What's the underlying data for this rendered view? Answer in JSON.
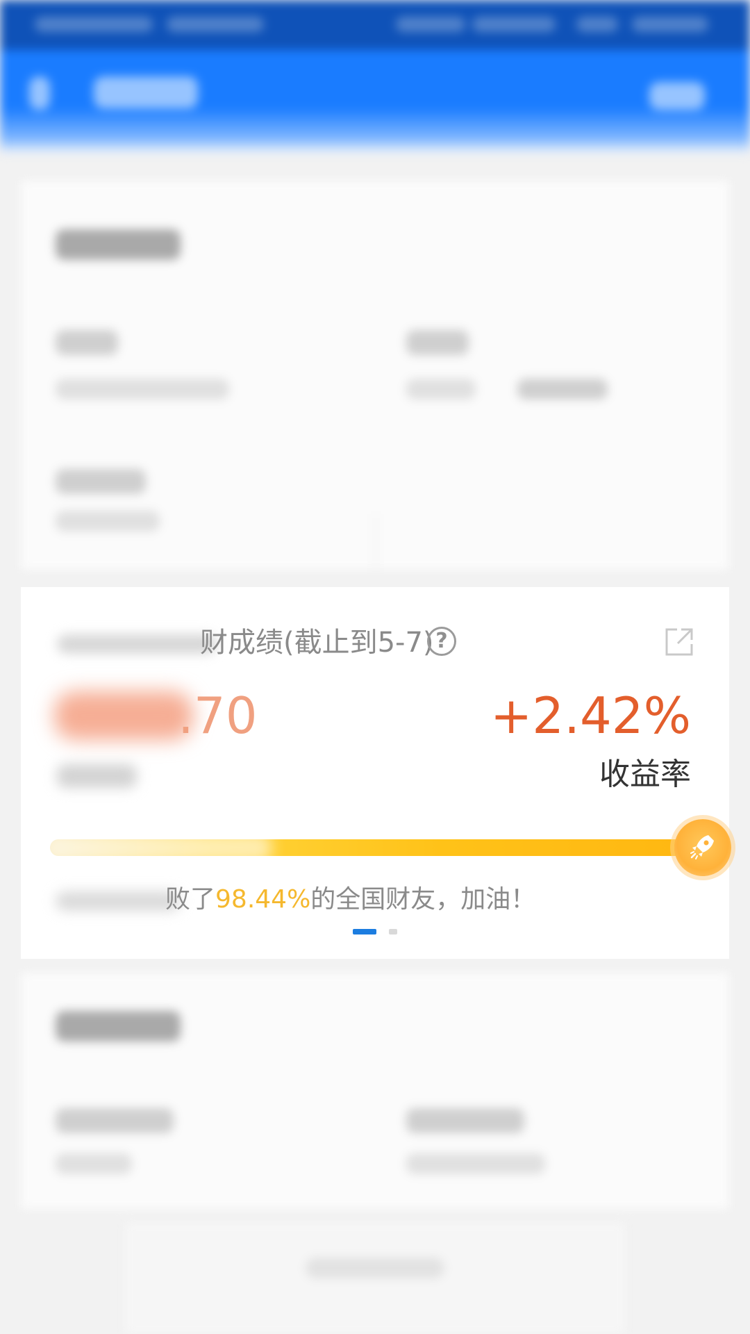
{
  "performance": {
    "title": "财成绩(截止到5-7)",
    "profit_amount": ".70",
    "rate_value": "+2.42%",
    "rate_label": "收益率",
    "beat_prefix": "败了",
    "beat_percent": "98.44%",
    "beat_suffix": "的全国财友，加油！",
    "progress_fraction": 0.9844,
    "pager": {
      "count": 2,
      "active": 0
    }
  },
  "icons": {
    "help": "help-circle-icon",
    "share": "share-icon",
    "knob": "rocket-icon"
  },
  "colors": {
    "accent_blue": "#1a7cff",
    "rate_orange": "#e35e2c",
    "profit_orange": "#f0a080",
    "highlight_yellow": "#f5b82e",
    "progress_yellow": "#ffc218",
    "pager_active": "#1c7de0"
  }
}
